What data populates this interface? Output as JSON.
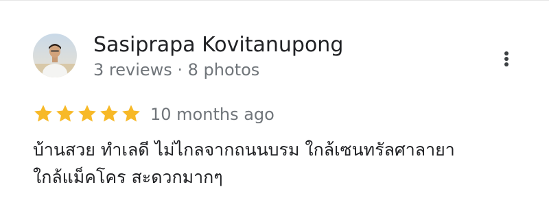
{
  "review": {
    "author": {
      "name": "Sasiprapa Kovitanupong",
      "meta": "3 reviews · 8 photos",
      "avatar_icon": "profile-photo"
    },
    "menu_icon": "more-vert-icon",
    "rating": 5,
    "rating_max": 5,
    "star_color": "#f7b928",
    "time": "10 months ago",
    "text_lines": [
      "บ้านสวย ทำเลดี ไม่ไกลจากถนนบรม ใกล้เซนทรัลศาลายา",
      "ใกล้แม็คโคร สะดวกมากๆ"
    ]
  }
}
